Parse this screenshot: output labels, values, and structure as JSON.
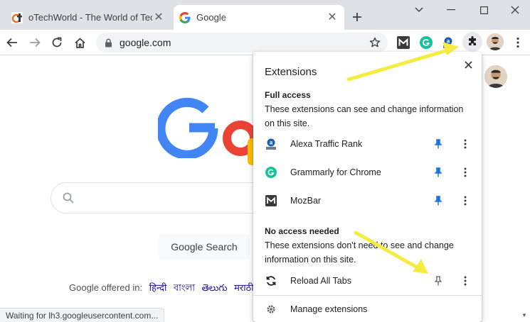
{
  "tabs": [
    {
      "title": "oTechWorld - The World of Tech",
      "favicon": "otechworld-favicon"
    },
    {
      "title": "Google",
      "favicon": "google-g-icon"
    }
  ],
  "toolbar": {
    "url": "google.com"
  },
  "google": {
    "search_button": "Google Search",
    "offered_in": "Google offered in:",
    "languages": [
      "हिन्दी",
      "বাংলা",
      "తెలుగు",
      "मराठी"
    ]
  },
  "status": "Waiting for lh3.googleusercontent.com...",
  "popup": {
    "title": "Extensions",
    "full_access": {
      "title": "Full access",
      "desc": "These extensions can see and change information on this site."
    },
    "no_access": {
      "title": "No access needed",
      "desc": "These extensions don't need to see and change information on this site."
    },
    "extensions_full": [
      {
        "name": "Alexa Traffic Rank",
        "icon": "alexa-icon",
        "pinned": true
      },
      {
        "name": "Grammarly for Chrome",
        "icon": "grammarly-icon",
        "pinned": true
      },
      {
        "name": "MozBar",
        "icon": "mozbar-icon",
        "pinned": true
      }
    ],
    "extensions_none": [
      {
        "name": "Reload All Tabs",
        "icon": "reload-icon",
        "pinned": false
      }
    ],
    "manage": "Manage extensions"
  },
  "colors": {
    "tabstrip": "#dee1e6",
    "pin_active": "#1a73e8",
    "annotation_arrow": "#f5ec42"
  }
}
